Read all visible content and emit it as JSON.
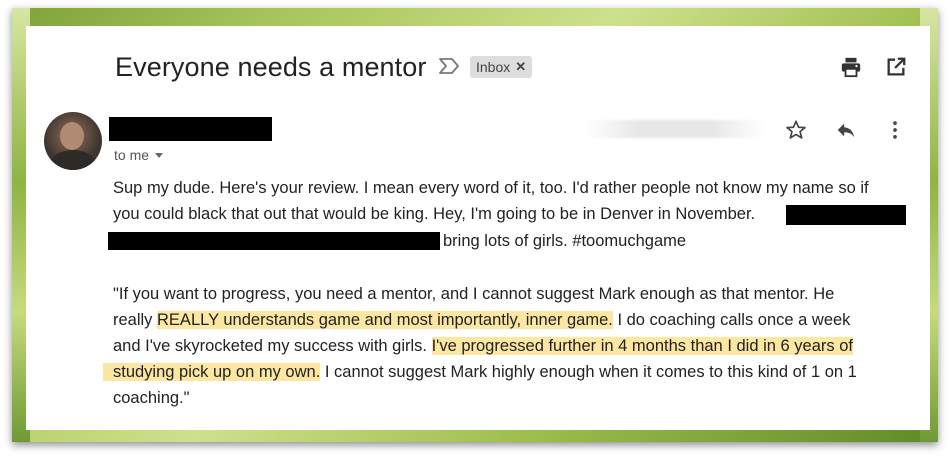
{
  "email": {
    "subject": "Everyone needs a mentor",
    "label": "Inbox",
    "recipient": "to me",
    "intro_lines": [
      "Sup my dude. Here's your review. I mean every word of it, too. I'd rather people not know my name so if",
      "you could black that out that would be king. Hey, I'm going to be in Denver in November.",
      "bring lots of girls. #toomuchgame"
    ],
    "quote": {
      "l1": "\"If you want to progress, you need a mentor, and I cannot suggest Mark enough as that mentor. He",
      "l2_pre": "really ",
      "l2_hl": "REALLY understands game and most importantly, inner game.",
      "l2_post": " I do coaching calls once a week",
      "l3_pre": "and I've skyrocketed my success with girls. ",
      "l3_hl": "I've progressed further in 4 months than I did in 6 years of",
      "l4_hl": "studying pick up on my own.",
      "l4_post": " I cannot suggest Mark highly enough when it comes to this kind of 1 on 1",
      "l5": "coaching.\""
    }
  },
  "icons": {
    "important": "important-marker-icon",
    "print": "print-icon",
    "open_new": "open-in-new-window-icon",
    "star": "star-icon",
    "reply": "reply-icon",
    "more": "more-vertical-icon",
    "label_remove": "close-icon"
  },
  "colors": {
    "highlight": "#fbe7a2",
    "redaction": "#000000"
  }
}
